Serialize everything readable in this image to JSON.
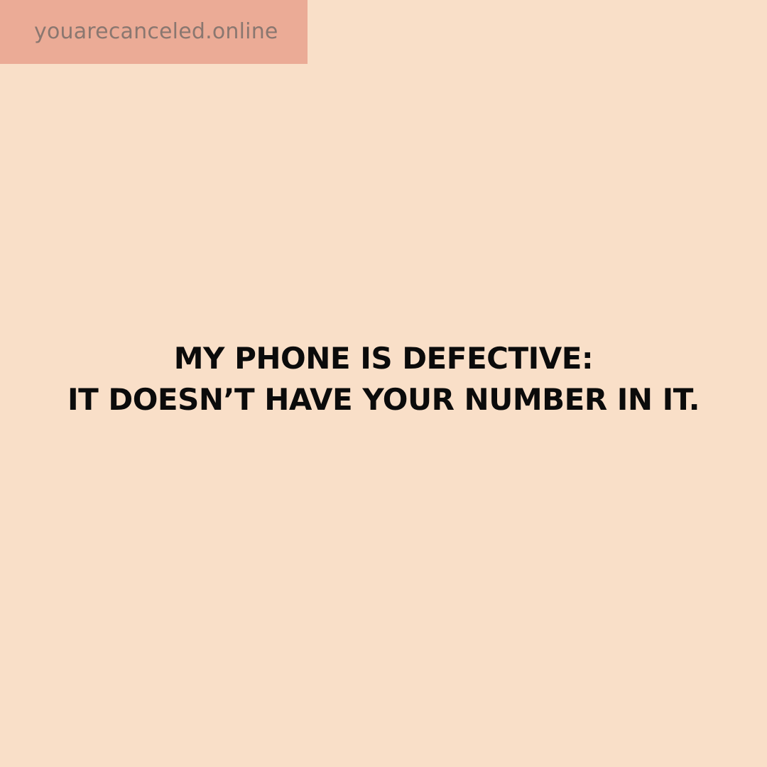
{
  "header": {
    "site_label": "youarecanceled.online"
  },
  "quote": {
    "line1": "MY PHONE IS DEFECTIVE:",
    "line2": "IT DOESN’T HAVE YOUR NUMBER IN IT."
  },
  "colors": {
    "background": "#f9dfc8",
    "badge": "#ebab96",
    "badge_text": "#8a7770",
    "quote_text": "#0b0b0b"
  }
}
